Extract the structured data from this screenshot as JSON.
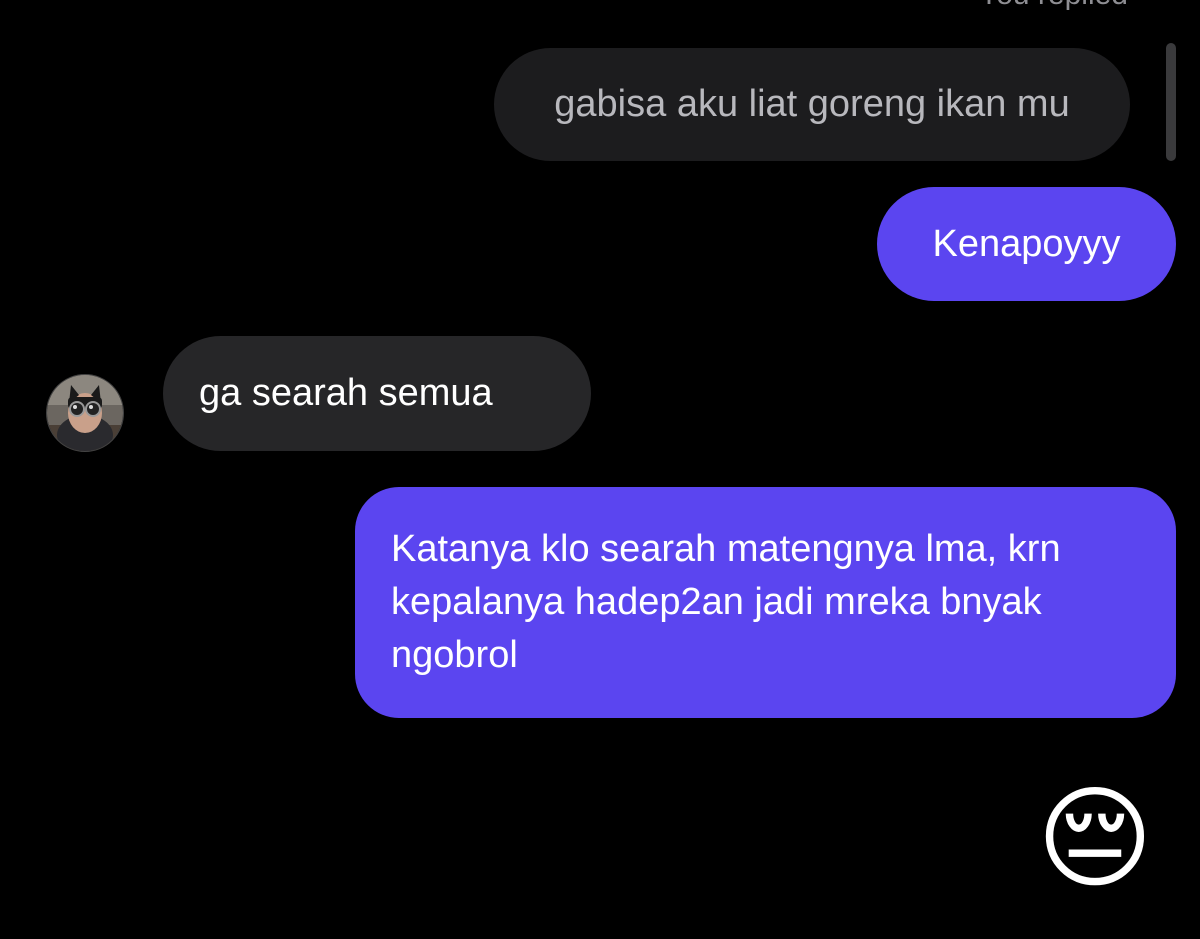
{
  "thread": {
    "reply_context_label": "You replied",
    "messages": [
      {
        "direction": "outgoing-reply",
        "text": "gabisa aku liat goreng ikan mu"
      },
      {
        "direction": "outgoing",
        "text": "Kenapoyyy"
      },
      {
        "direction": "incoming",
        "text": "ga searah semua"
      },
      {
        "direction": "outgoing",
        "text": "Katanya klo searah matengnya lma, krn kepalanya hadep2an jadi mreka bnyak ngobrol"
      },
      {
        "direction": "outgoing",
        "text": "😔"
      }
    ]
  },
  "icons": {
    "avatar": "contact-avatar-icon",
    "emoji": "pensive-face-emoji"
  },
  "colors": {
    "background": "#000000",
    "sent_bubble": "#5b45f0",
    "received_bubble": "#262628",
    "reply_bubble": "#1c1c1e",
    "secondary_text": "#8e8e93"
  }
}
